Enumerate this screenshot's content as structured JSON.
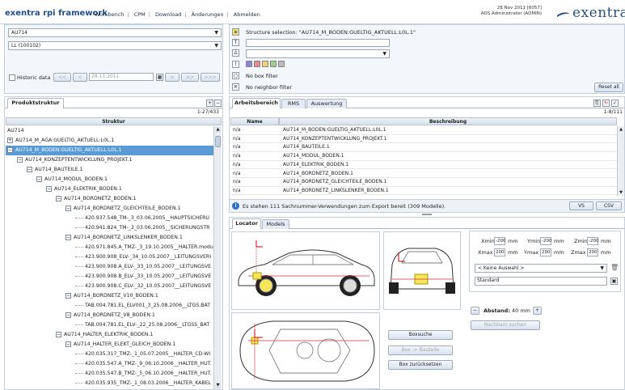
{
  "header": {
    "app_title": "exentra rpi framework",
    "nav": [
      "Workbench",
      "CPM",
      "Download",
      "Änderungen",
      "Abmelden"
    ],
    "user_date": "28 Nov 2011 [6057]",
    "user_name": "ADS Administrator (ADMIN)",
    "brand": "exentra"
  },
  "left": {
    "select1": "AU714",
    "select2": "LL (100102)",
    "historic_label": "Historic data",
    "pager": [
      "<<",
      "<",
      ">",
      ">>",
      ">>>"
    ],
    "date": "28.11.2011",
    "tab": "Produktstruktur",
    "count": "1-27/433",
    "col": "Struktur",
    "tree": [
      {
        "t": "AU714",
        "lvl": 0,
        "pm": ""
      },
      {
        "t": "AU714_M_AGA:GUELTIG_AKTUELL:L0L.1",
        "lvl": 0,
        "pm": "+"
      },
      {
        "t": "AU714_M_BODEN:GUELTIG_AKTUELL:L0L.1",
        "lvl": 0,
        "pm": "−",
        "hl": true
      },
      {
        "t": "AU714_KONZEPTENTWICKLUNG_PROJEKT.1",
        "lvl": 1,
        "pm": "−"
      },
      {
        "t": "AU714_BAUTEILE.1",
        "lvl": 2,
        "pm": "−"
      },
      {
        "t": "AU714_MODUL_BODEN.1",
        "lvl": 3,
        "pm": "−"
      },
      {
        "t": "AU714_ELEKTRIK_BODEN.1",
        "lvl": 4,
        "pm": "−"
      },
      {
        "t": "AU714_BORDNETZ_BODEN.1",
        "lvl": 5,
        "pm": "−"
      },
      {
        "t": "AU714_BORDNETZ_GLEICHTEILE_BODEN.1",
        "lvl": 6,
        "pm": "−"
      },
      {
        "t": "420.937.548_TM-_3_03.06.2005__HAUPTSICHERU",
        "lvl": 7,
        "pm": ""
      },
      {
        "t": "420.941.824_TM-_2_03.06.2005__SICHERUNGSTR",
        "lvl": 7,
        "pm": ""
      },
      {
        "t": "AU714_BORDNETZ_LINKSLENKER_BODEN.1",
        "lvl": 6,
        "pm": "−"
      },
      {
        "t": "420.971.845.A_TMZ-_3_19.10.2005__HALTER.modu",
        "lvl": 7,
        "pm": ""
      },
      {
        "t": "423.900.908_ELV-_34_10.05.2007__LEITUNGSVERI",
        "lvl": 7,
        "pm": ""
      },
      {
        "t": "423.900.908.A_ELV-_33_10.05.2007__LEITUNGSVE",
        "lvl": 7,
        "pm": ""
      },
      {
        "t": "423.900.908.B_ELV-_33_10.05.2007__LEITUNGSVE",
        "lvl": 7,
        "pm": ""
      },
      {
        "t": "423.900.908.C_ELV-_32_10.05.2007__LEITUNGSVE",
        "lvl": 7,
        "pm": ""
      },
      {
        "t": "AU714_BORDNETZ_V10_BODEN.1",
        "lvl": 6,
        "pm": "−"
      },
      {
        "t": "TAB.004.781.EL_ELV001_3_25.08.2006__LTGS.BAT",
        "lvl": 7,
        "pm": ""
      },
      {
        "t": "AU714_BORDNETZ_V8_BODEN.1",
        "lvl": 6,
        "pm": "−"
      },
      {
        "t": "TAB.004.781.EL_ELV-_22_25.08.2006__LTGSS_BAT",
        "lvl": 7,
        "pm": ""
      },
      {
        "t": "AU714_HALTER_ELEKTRIK_BODEN.1",
        "lvl": 5,
        "pm": "−"
      },
      {
        "t": "AU714_HALTER_ELEKT_GLEICH_BODEN.1",
        "lvl": 6,
        "pm": "−"
      },
      {
        "t": "420.035.317_TMZ-_1_05.07.2005__HALTER_CD-WI",
        "lvl": 7,
        "pm": ""
      },
      {
        "t": "420.035.547.A_TMZ-_9_06.10.2006__HALTER_HUT.",
        "lvl": 7,
        "pm": ""
      },
      {
        "t": "420.035.547.B_TMZ-_5_06.10.2006__HALTER_HUT.",
        "lvl": 7,
        "pm": ""
      },
      {
        "t": "420.035.935_TMZ-_1_08.03.2006__HALTER_KABEL",
        "lvl": 7,
        "pm": ""
      }
    ]
  },
  "right": {
    "structure_selection": "Structure selection: \"AU714_M_BODEN:GUELTIG_AKTUELL:L0L.1\"",
    "no_box": "No box filter",
    "no_neighbor": "No neighbor filter",
    "reset": "Reset all",
    "tabs": [
      "Arbeitsbereich",
      "RMS",
      "Auswertung"
    ],
    "count": "1-8/111",
    "col_name": "Name",
    "col_desc": "Beschreibung",
    "rows": [
      {
        "n": "n/a",
        "d": "AU714_M_BODEN:GUELTIG_AKTUELL:L0L.1"
      },
      {
        "n": "n/a",
        "d": "AU714_KONZEPTENTWICKLUNG_PROJEKT.1"
      },
      {
        "n": "n/a",
        "d": "AU714_BAUTEILE.1"
      },
      {
        "n": "n/a",
        "d": "AU714_MODUL_BODEN.1"
      },
      {
        "n": "n/a",
        "d": "AU714_ELEKTRIK_BODEN.1"
      },
      {
        "n": "n/a",
        "d": "AU714_BORDNETZ_BODEN.1"
      },
      {
        "n": "n/a",
        "d": "AU714_BORDNETZ_GLEICHTEILE_BODEN.1"
      },
      {
        "n": "n/a",
        "d": "AU714_BORDNETZ_LINKSLENKER_BODEN.1"
      }
    ],
    "info": "Es stehen 111 Sachnummer-Verwendungen zum Export bereit (309 Modelle).",
    "vs": "VS",
    "csv": "CSV",
    "subtabs": [
      "Locator",
      "Models"
    ],
    "xmin_l": "Xmin",
    "xmin": "-200",
    "ymin_l": "Ymin",
    "ymin": "-200",
    "zmin_l": "Zmin",
    "zmin": "-200",
    "xmax_l": "Xmax",
    "xmax": "200",
    "ymax_l": "Ymax",
    "ymax": "200",
    "zmax_l": "Zmax",
    "zmax": "200",
    "unit": "mm",
    "keine": "< Keine Auswahl >",
    "standard": "Standard",
    "abstand_l": "Abstand:",
    "abstand": "40 mm",
    "nachbarn": "Nachbarn suchen",
    "boxsuche": "Boxsuche",
    "box_bauteile": "Box -> Bauteile",
    "box_reset": "Box zurücksetzen"
  },
  "colors": {
    "highlight": "#5b9bd5",
    "brand": "#2a4f86"
  }
}
